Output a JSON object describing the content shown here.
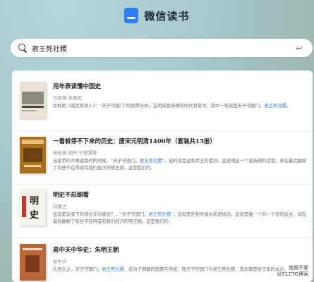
{
  "app": {
    "title": "微信读书"
  },
  "search": {
    "query": "君王死社稷",
    "clear_icon": "return-arrow-icon"
  },
  "results": [
    {
      "title": "用年表读懂中国史",
      "author": "马前锋 朱展宏",
      "snippet_pre": "余秋雨《威尼斯商人》：“天子守国门”的利弊分析，在明成祖朱棣的时代背景中，其中一条就是天子守国门，",
      "snippet_hl": "君王死社稷",
      "snippet_post": "。"
    },
    {
      "title": "一看就停不下来的历史：唐宋元明清1400年（套装共15册）",
      "author": "杨宏瑞 胡丹 宁德慧等",
      "snippet_pre": "当皇帝的不敢逃跑时的时候，“天子守国门，",
      "snippet_hl": "君王死社稷",
      "snippet_post": "”，说的就是这条帝王的遗训。这说明这一个皇族规的运营，却在最后翻掉了有些不在得或有我们经济的明王朝，这是我们的。"
    },
    {
      "title": "明史不忍细看",
      "author": "向敬之",
      "snippet_pre": "这就是亲身下的帝位计的感觉？，“天子守国门，",
      "snippet_hl": "君王死社稷",
      "snippet_post": "”，这就是崇祯帝身份和坚持的。这就是我一个的一个任的后台，却在最后翻掉了有些不在得或有我们经济的明王朝，这是我们的。"
    },
    {
      "title": "易中天中华史：朱明王朝",
      "author": "易中天",
      "snippet_pre": "久而久之，天子守国门，",
      "snippet_hl": "君王死社稷",
      "snippet_post": "，成为了明朝的国策与传统，而天子守国门与君王死社稷，其实都是帝王家的本分。"
    }
  ],
  "watermark": {
    "line1": "就是不爱",
    "line2": "@51CTO博客"
  }
}
